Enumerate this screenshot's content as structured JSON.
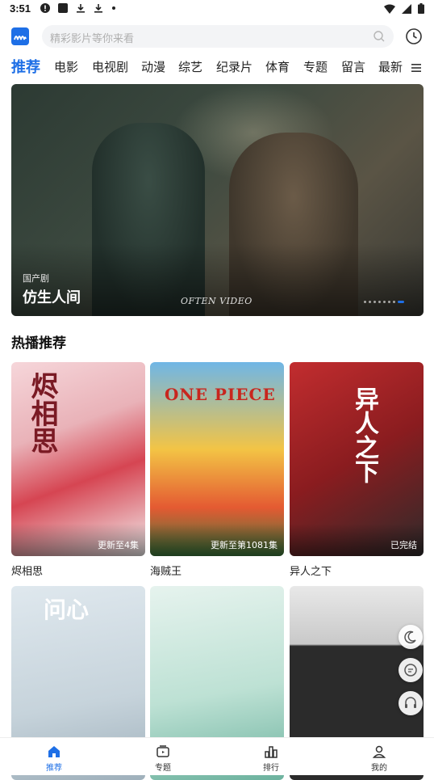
{
  "status_bar": {
    "time": "3:51"
  },
  "search": {
    "placeholder": "精彩影片等你来看"
  },
  "tabs": [
    "推荐",
    "电影",
    "电视剧",
    "动漫",
    "综艺",
    "纪录片",
    "体育",
    "专题",
    "留言",
    "最新"
  ],
  "banner": {
    "tag": "国产剧",
    "title": "仿生人间",
    "watermark": "OFTEN VIDEO",
    "dot_count": 8,
    "active_dot": 8
  },
  "section": {
    "title": "热播推荐"
  },
  "cards": [
    {
      "title": "烬相思",
      "badge": "更新至4集",
      "poster_text": "烬相思"
    },
    {
      "title": "海贼王",
      "badge": "更新至第1081集",
      "poster_text": "ONE PIECE"
    },
    {
      "title": "异人之下",
      "badge": "已完结",
      "poster_text": "异人之下"
    },
    {
      "title": "",
      "badge": "",
      "poster_text": "问心"
    },
    {
      "title": "",
      "badge": "",
      "poster_text": ""
    },
    {
      "title": "",
      "badge": "",
      "poster_text": ""
    }
  ],
  "bottom_nav": [
    {
      "label": "推荐",
      "icon": "home-icon",
      "active": true
    },
    {
      "label": "专题",
      "icon": "topic-icon",
      "active": false
    },
    {
      "label": "排行",
      "icon": "rank-icon",
      "active": false
    },
    {
      "label": "我的",
      "icon": "profile-icon",
      "active": false
    }
  ],
  "colors": {
    "accent": "#1e6fe6"
  }
}
